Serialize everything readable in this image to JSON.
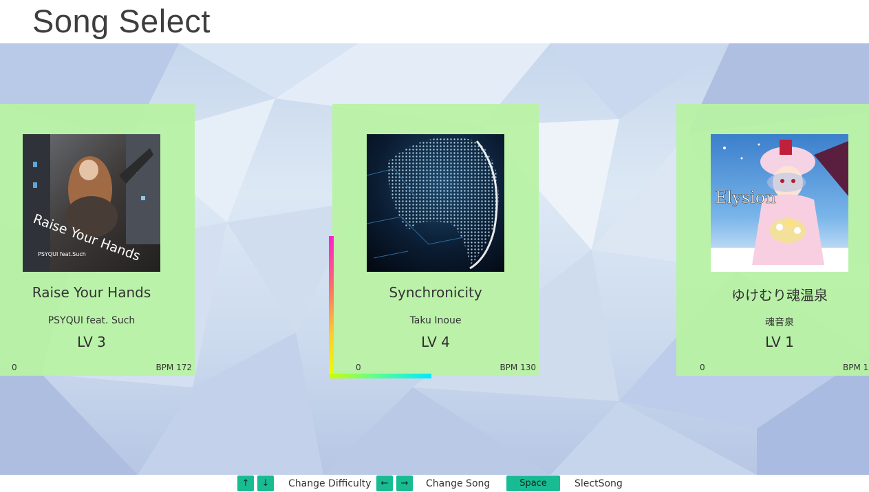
{
  "header": {
    "title": "Song Select"
  },
  "songs": [
    {
      "title": "Raise Your Hands",
      "artist": "PSYQUI feat. Such",
      "level": "LV 3",
      "score": "0",
      "bpm": "BPM 172",
      "cover_text": "Raise Your Hands",
      "cover_sub": "PSYQUI feat.Such"
    },
    {
      "title": "Synchronicity",
      "artist": "Taku Inoue",
      "level": "LV 4",
      "score": "0",
      "bpm": "BPM 130"
    },
    {
      "title": "ゆけむり魂温泉",
      "artist": "魂音泉",
      "level": "LV 1",
      "score": "0",
      "bpm": "BPM 1",
      "cover_text": "Elysion"
    }
  ],
  "footer": {
    "up_key": "↑",
    "down_key": "↓",
    "difficulty_label": "Change Difficulty",
    "left_key": "←",
    "right_key": "→",
    "song_label": "Change Song",
    "space_key": "Space",
    "select_label": "SlectSong"
  },
  "colors": {
    "card": "#b8f2a4",
    "key": "#19bb92",
    "cursor_v": "#ff1ed2",
    "cursor_h": "#00e8ff"
  }
}
